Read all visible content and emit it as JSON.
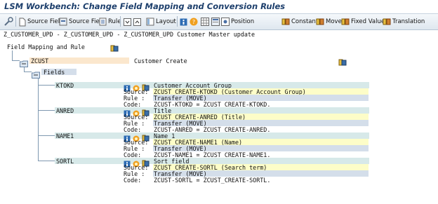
{
  "window": {
    "title": "LSM Workbench: Change Field Mapping and Conversion Rules"
  },
  "toolbar": {
    "source_field_1": "Source Field",
    "source_field_2": "Source Field",
    "rule": "Rule",
    "layout": "Layout",
    "position": "Position",
    "constant": "Constant",
    "move": "Move",
    "fixed_value": "Fixed Value",
    "translation": "Translation"
  },
  "header": {
    "object_line": "Z_CUSTOMER_UPD - Z_CUSTOMER_UPD - Z_CUSTOMER_UPD Customer Master update"
  },
  "tree": {
    "root_label": "Field Mapping and Rule",
    "structure_name": "ZCUST",
    "structure_desc": "Customer Create",
    "fields_label": "Fields",
    "fields": [
      {
        "name": "KTOKD",
        "desc": "Customer Account Group",
        "source_label": "Source:",
        "source": "ZCUST_CREATE-KTOKD (Customer Account Group)",
        "rule_label": "Rule :",
        "rule": "Transfer (MOVE)",
        "code_label": "Code:",
        "code": "ZCUST-KTOKD = ZCUST_CREATE-KTOKD."
      },
      {
        "name": "ANRED",
        "desc": "Title",
        "source_label": "Source:",
        "source": "ZCUST_CREATE-ANRED (Title)",
        "rule_label": "Rule :",
        "rule": "Transfer (MOVE)",
        "code_label": "Code:",
        "code": "ZCUST-ANRED = ZCUST_CREATE-ANRED."
      },
      {
        "name": "NAME1",
        "desc": "Name 1",
        "source_label": "Source:",
        "source": "ZCUST_CREATE-NAME1 (Name)",
        "rule_label": "Rule :",
        "rule": "Transfer (MOVE)",
        "code_label": "Code:",
        "code": "ZCUST-NAME1 = ZCUST_CREATE-NAME1."
      },
      {
        "name": "SORTL",
        "desc": "Sort field",
        "source_label": "Source:",
        "source": "ZCUST_CREATE-SORTL (Search term)",
        "rule_label": "Rule :",
        "rule": "Transfer (MOVE)",
        "code_label": "Code:",
        "code": "ZCUST-SORTL = ZCUST_CREATE-SORTL."
      }
    ]
  },
  "colors": {
    "title": "#1d3f6c",
    "source_row": "#fdfdc8",
    "rule_row": "#d4deea",
    "field_row": "#d7e9e9",
    "tree_line": "#7f98b0"
  }
}
